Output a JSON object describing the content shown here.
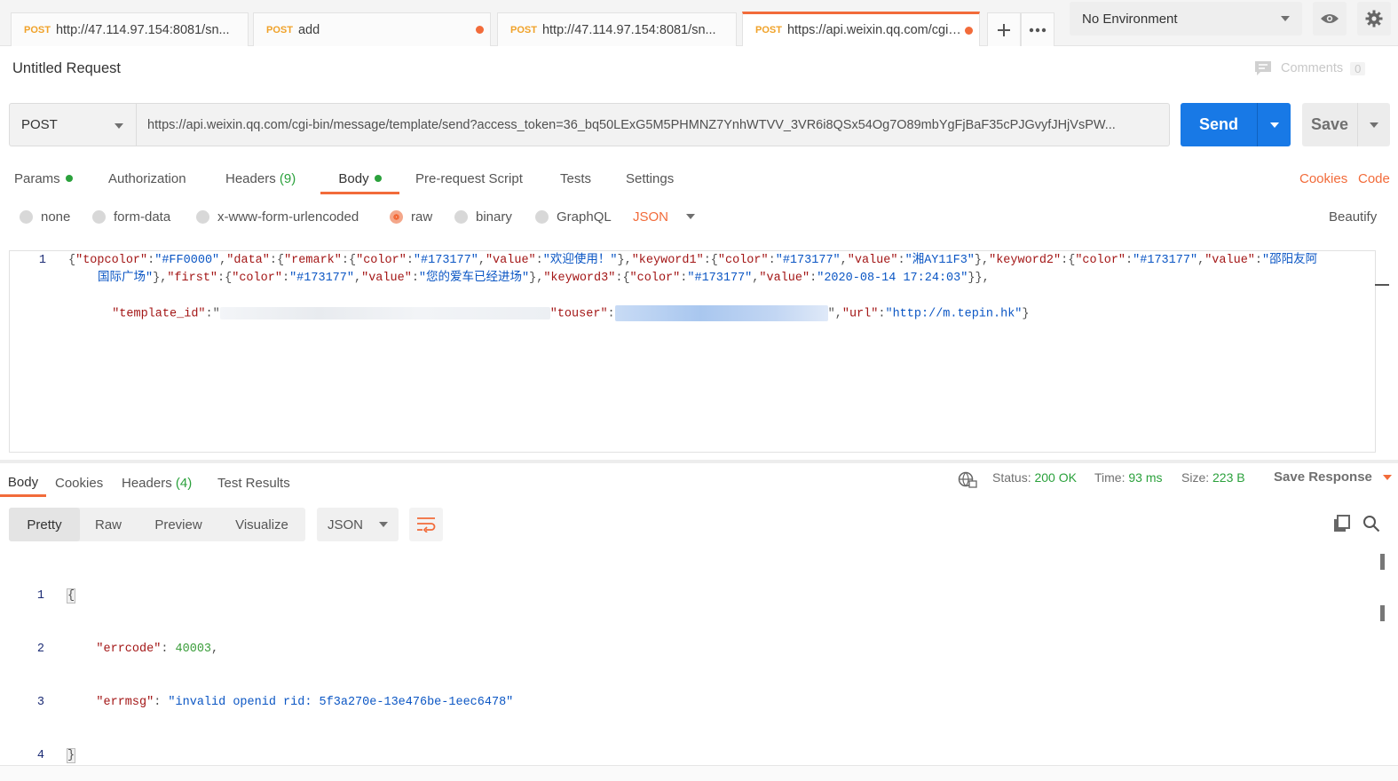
{
  "tabs": [
    {
      "method": "POST",
      "title": "http://47.114.97.154:8081/sn...",
      "unsaved": false,
      "active": false
    },
    {
      "method": "POST",
      "title": "add",
      "unsaved": true,
      "active": false
    },
    {
      "method": "POST",
      "title": "http://47.114.97.154:8081/sn...",
      "unsaved": false,
      "active": false
    },
    {
      "method": "POST",
      "title": "https://api.weixin.qq.com/cgi-...",
      "unsaved": true,
      "active": true
    }
  ],
  "environment": {
    "selected": "No Environment"
  },
  "request": {
    "name": "Untitled Request",
    "comments_label": "Comments",
    "comments_count": "0",
    "method": "POST",
    "url": "https://api.weixin.qq.com/cgi-bin/message/template/send?access_token=36_bq50LExG5M5PHMNZ7YnhWTVV_3VR6i8QSx54Og7O89mbYgFjBaF35cPJGvyfJHjVsPW...",
    "send_label": "Send",
    "save_label": "Save"
  },
  "request_tabs": {
    "params": "Params",
    "authorization": "Authorization",
    "headers": "Headers",
    "headers_count": "(9)",
    "body": "Body",
    "prerequest": "Pre-request Script",
    "tests": "Tests",
    "settings": "Settings",
    "cookies": "Cookies",
    "code": "Code"
  },
  "body_types": {
    "none": "none",
    "form_data": "form-data",
    "urlencoded": "x-www-form-urlencoded",
    "raw": "raw",
    "binary": "binary",
    "graphql": "GraphQL",
    "format": "JSON",
    "beautify": "Beautify"
  },
  "request_body": {
    "line_number": "1",
    "l1": [
      [
        "p",
        "{"
      ],
      [
        "k",
        "\"topcolor\""
      ],
      [
        "p",
        ":"
      ],
      [
        "s",
        "\"#FF0000\""
      ],
      [
        "p",
        ","
      ],
      [
        "k",
        "\"data\""
      ],
      [
        "p",
        ":{"
      ],
      [
        "k",
        "\"remark\""
      ],
      [
        "p",
        ":{"
      ],
      [
        "k",
        "\"color\""
      ],
      [
        "p",
        ":"
      ],
      [
        "s",
        "\"#173177\""
      ],
      [
        "p",
        ","
      ],
      [
        "k",
        "\"value\""
      ],
      [
        "p",
        ":"
      ],
      [
        "s",
        "\"欢迎使用！\""
      ],
      [
        "p",
        "},"
      ],
      [
        "k",
        "\"keyword1\""
      ],
      [
        "p",
        ":{"
      ],
      [
        "k",
        "\"color\""
      ],
      [
        "p",
        ":"
      ],
      [
        "s",
        "\"#173177\""
      ],
      [
        "p",
        ","
      ],
      [
        "k",
        "\"value\""
      ],
      [
        "p",
        ":"
      ],
      [
        "s",
        "\"湘AY11F3\""
      ],
      [
        "p",
        "},"
      ],
      [
        "k",
        "\"keyword2\""
      ],
      [
        "p",
        ":{"
      ],
      [
        "k",
        "\"color\""
      ],
      [
        "p",
        ":"
      ],
      [
        "s",
        "\"#173177\""
      ],
      [
        "p",
        ","
      ],
      [
        "k",
        "\"value\""
      ],
      [
        "p",
        ":"
      ],
      [
        "s",
        "\"邵阳友阿"
      ]
    ],
    "l2": [
      [
        "s",
        "国际广场\""
      ],
      [
        "p",
        "},"
      ],
      [
        "k",
        "\"first\""
      ],
      [
        "p",
        ":{"
      ],
      [
        "k",
        "\"color\""
      ],
      [
        "p",
        ":"
      ],
      [
        "s",
        "\"#173177\""
      ],
      [
        "p",
        ","
      ],
      [
        "k",
        "\"value\""
      ],
      [
        "p",
        ":"
      ],
      [
        "s",
        "\"您的爱车已经进场\""
      ],
      [
        "p",
        "},"
      ],
      [
        "k",
        "\"keyword3\""
      ],
      [
        "p",
        ":{"
      ],
      [
        "k",
        "\"color\""
      ],
      [
        "p",
        ":"
      ],
      [
        "s",
        "\"#173177\""
      ],
      [
        "p",
        ","
      ],
      [
        "k",
        "\"value\""
      ],
      [
        "p",
        ":"
      ],
      [
        "s",
        "\"2020-08-14 17:24:03\""
      ],
      [
        "p",
        "}},"
      ]
    ],
    "l3a": "\"template_id\"",
    "l3b": ":\"",
    "l3c": "\"touser\"",
    "l3d": ":",
    "l3e": "\",",
    "l3f": "\"url\"",
    "l3g": ":",
    "l3h": "\"http://m.tepin.hk\"",
    "l3i": "}"
  },
  "response_tabs": {
    "body": "Body",
    "cookies": "Cookies",
    "headers": "Headers",
    "headers_count": "(4)",
    "test_results": "Test Results"
  },
  "response_meta": {
    "status_label": "Status:",
    "status": "200 OK",
    "time_label": "Time:",
    "time": "93 ms",
    "size_label": "Size:",
    "size": "223 B",
    "save_response": "Save Response"
  },
  "response_view": {
    "pretty": "Pretty",
    "raw": "Raw",
    "preview": "Preview",
    "visualize": "Visualize",
    "format": "JSON"
  },
  "response_body": {
    "numbers": [
      "1",
      "2",
      "3",
      "4"
    ],
    "open": "{",
    "errcode_key": "\"errcode\"",
    "errcode_val": "40003",
    "errmsg_key": "\"errmsg\"",
    "errmsg_val": "\"invalid openid rid: 5f3a270e-13e476be-1eec6478\"",
    "close": "}"
  },
  "colors": {
    "accent": "#f26b3a",
    "send": "#1879e6",
    "success": "#2ba13c",
    "method": "#f0a229",
    "json_key": "#a31616",
    "json_string": "#0b56c4"
  }
}
